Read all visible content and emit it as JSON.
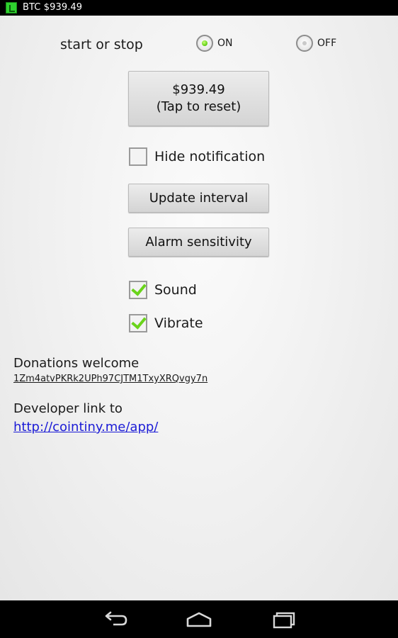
{
  "status_bar": {
    "text": "BTC $939.49",
    "icon": "bitcoin-app-icon"
  },
  "toggle": {
    "label": "start or stop",
    "on_label": "ON",
    "off_label": "OFF",
    "selected": "ON"
  },
  "price_button": {
    "line1": "$939.49",
    "line2": "(Tap to reset)"
  },
  "hide_notification": {
    "label": "Hide notification",
    "checked": false
  },
  "update_interval_label": "Update interval",
  "alarm_sensitivity_label": "Alarm sensitivity",
  "sound": {
    "label": "Sound",
    "checked": true
  },
  "vibrate": {
    "label": "Vibrate",
    "checked": true
  },
  "donations": {
    "title": "Donations welcome",
    "address": "1Zm4atvPKRk2UPh97CJTM1TxyXRQvgy7n"
  },
  "developer": {
    "title": "Developer link to",
    "link": "http://cointiny.me/app/"
  },
  "nav_bar": {
    "icons": [
      "back-icon",
      "home-icon",
      "recent-apps-icon"
    ]
  },
  "colors": {
    "accent_green": "#6ad41b",
    "link": "#1b1bd6",
    "status_bar": "#000000"
  }
}
